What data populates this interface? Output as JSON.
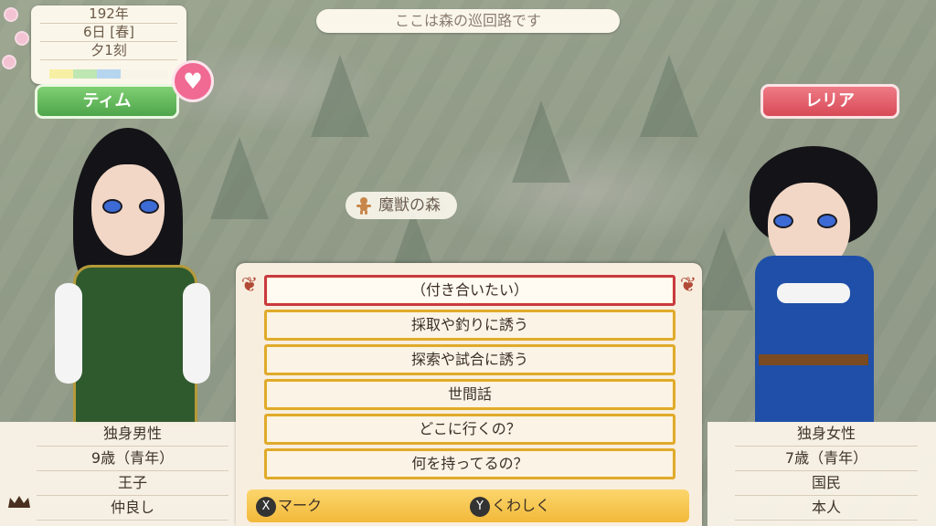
{
  "location_banner": "ここは森の巡回路です",
  "date": {
    "year": "192年",
    "day": "6日 [春]",
    "time": "夕1刻",
    "weather_colors": [
      "#f7f0a4",
      "#bfe7b3",
      "#b6d5ef",
      "#f8f4e8",
      "#f8f4e8"
    ]
  },
  "left_character": {
    "name": "ティム",
    "badge_icon": "heart-icon",
    "info": [
      "独身男性",
      "9歳（青年）",
      "王子",
      "仲良し"
    ],
    "info_icon": "crown-icon"
  },
  "right_character": {
    "name": "レリア",
    "info": [
      "独身女性",
      "7歳（青年）",
      "国民",
      "本人"
    ]
  },
  "map_marker": {
    "icon": "gingerbread-icon",
    "label": "魔獣の森"
  },
  "dialog": {
    "choices": [
      {
        "label": "（付き合いたい）",
        "selected": true
      },
      {
        "label": "採取や釣りに誘う",
        "selected": false
      },
      {
        "label": "探索や試合に誘う",
        "selected": false
      },
      {
        "label": "世間話",
        "selected": false
      },
      {
        "label": "どこに行くの？",
        "selected": false
      },
      {
        "label": "何を持ってるの？",
        "selected": false
      }
    ],
    "hints": [
      {
        "button": "X",
        "label": "マーク"
      },
      {
        "button": "Y",
        "label": "くわしく"
      }
    ]
  },
  "colors": {
    "accent_gold": "#e0aa2a",
    "selected_red": "#c9393f",
    "male_green": "#4fa54a",
    "female_red": "#d84a57"
  }
}
